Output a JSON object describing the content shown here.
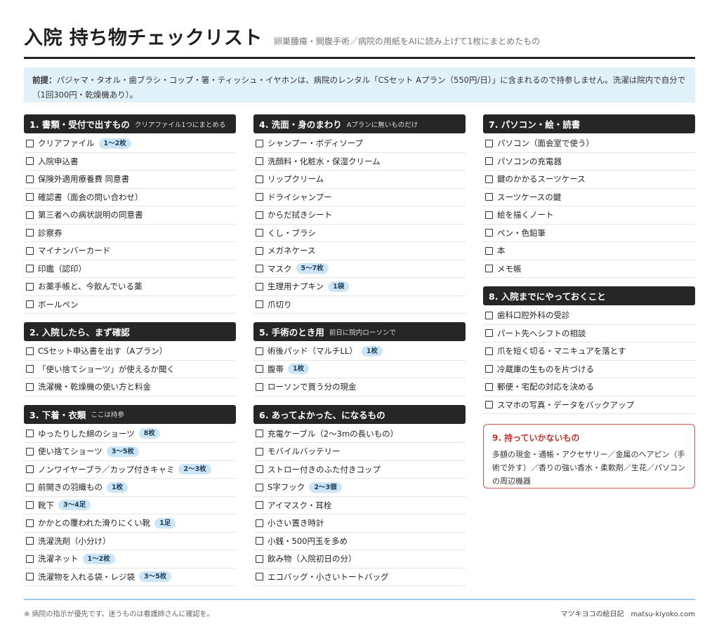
{
  "header": {
    "title": "入院 持ち物チェックリスト",
    "subtitle": "卵巣腫瘍・開腹手術／病院の用紙をAIに読み上げて1枚にまとめたもの"
  },
  "premise": {
    "label": "前提：",
    "text": "パジャマ・タオル・歯ブラシ・コップ・箸・ティッシュ・イヤホンは、病院のレンタル「CSセット Aプラン（550円/日）」に含まれるので持参しません。洗濯は院内で自分で（1回300円・乾燥機あり）。"
  },
  "sections": [
    {
      "title": "1. 書類・受付で出すもの",
      "note": "クリアファイル1つにまとめる",
      "items": [
        {
          "label": "クリアファイル",
          "badge": "1〜2枚"
        },
        {
          "label": "入院申込書"
        },
        {
          "label": "保険外適用療養費 同意書"
        },
        {
          "label": "確認書（面会の問い合わせ）"
        },
        {
          "label": "第三者への病状説明の同意書"
        },
        {
          "label": "診察券"
        },
        {
          "label": "マイナンバーカード"
        },
        {
          "label": "印鑑（認印）"
        },
        {
          "label": "お薬手帳と、今飲んでいる薬"
        },
        {
          "label": "ボールペン"
        }
      ]
    },
    {
      "title": "2. 入院したら、まず確認",
      "note": "",
      "items": [
        {
          "label": "CSセット申込書を出す（Aプラン）"
        },
        {
          "label": "「使い捨てショーツ」が使えるか聞く"
        },
        {
          "label": "洗濯機・乾燥機の使い方と料金"
        }
      ]
    },
    {
      "title": "3. 下着・衣類",
      "note": "ここは持参",
      "items": [
        {
          "label": "ゆったりした綿のショーツ",
          "badge": "8枚"
        },
        {
          "label": "使い捨てショーツ",
          "badge": "3〜5枚"
        },
        {
          "label": "ノンワイヤーブラ／カップ付きキャミ",
          "badge": "2〜3枚"
        },
        {
          "label": "前開きの羽織もの",
          "badge": "1枚"
        },
        {
          "label": "靴下",
          "badge": "3〜4足"
        },
        {
          "label": "かかとの覆われた滑りにくい靴",
          "badge": "1足"
        },
        {
          "label": "洗濯洗剤（小分け）"
        },
        {
          "label": "洗濯ネット",
          "badge": "1〜2枚"
        },
        {
          "label": "洗濯物を入れる袋・レジ袋",
          "badge": "3〜5枚"
        }
      ]
    },
    {
      "title": "4. 洗面・身のまわり",
      "note": "Aプランに無いものだけ",
      "items": [
        {
          "label": "シャンプー・ボディソープ"
        },
        {
          "label": "洗顔料・化粧水・保湿クリーム"
        },
        {
          "label": "リップクリーム"
        },
        {
          "label": "ドライシャンプー"
        },
        {
          "label": "からだ拭きシート"
        },
        {
          "label": "くし・ブラシ"
        },
        {
          "label": "メガネケース"
        },
        {
          "label": "マスク",
          "badge": "5〜7枚"
        },
        {
          "label": "生理用ナプキン",
          "badge": "1袋"
        },
        {
          "label": "爪切り"
        }
      ]
    },
    {
      "title": "5. 手術のとき用",
      "note": "前日に院内ローソンで",
      "items": [
        {
          "label": "術後パッド（マルチLL）",
          "badge": "1枚"
        },
        {
          "label": "腹帯",
          "badge": "1枚"
        },
        {
          "label": "ローソンで買う分の現金"
        }
      ]
    },
    {
      "title": "6. あってよかった、になるもの",
      "note": "",
      "items": [
        {
          "label": "充電ケーブル（2〜3mの長いもの）"
        },
        {
          "label": "モバイルバッテリー"
        },
        {
          "label": "ストロー付きのふた付きコップ"
        },
        {
          "label": "S字フック",
          "badge": "2〜3個"
        },
        {
          "label": "アイマスク・耳栓"
        },
        {
          "label": "小さい置き時計"
        },
        {
          "label": "小銭・500円玉を多め"
        },
        {
          "label": "飲み物（入院初日の分）"
        },
        {
          "label": "エコバッグ・小さいトートバッグ"
        }
      ]
    },
    {
      "title": "7. パソコン・絵・読書",
      "note": "",
      "items": [
        {
          "label": "パソコン（面会室で使う）"
        },
        {
          "label": "パソコンの充電器"
        },
        {
          "label": "鍵のかかるスーツケース"
        },
        {
          "label": "スーツケースの鍵"
        },
        {
          "label": "絵を描くノート"
        },
        {
          "label": "ペン・色鉛筆"
        },
        {
          "label": "本"
        },
        {
          "label": "メモ帳"
        }
      ]
    },
    {
      "title": "8. 入院までにやっておくこと",
      "note": "",
      "items": [
        {
          "label": "歯科口腔外科の受診"
        },
        {
          "label": "パート先へシフトの相談"
        },
        {
          "label": "爪を短く切る・マニキュアを落とす"
        },
        {
          "label": "冷蔵庫の生ものを片づける"
        },
        {
          "label": "郵便・宅配の対応を決める"
        },
        {
          "label": "スマホの写真・データをバックアップ"
        }
      ]
    }
  ],
  "not_bring": {
    "title": "9. 持っていかないもの",
    "text": "多額の現金・通帳・アクセサリー／金属のヘアピン（手術で外す）／香りの強い香水・柔軟剤／生花／パソコンの周辺機器"
  },
  "footer": {
    "note": "※ 病院の指示が優先です。迷うものは看護師さんに確認を。",
    "credit": "マツキヨコの絵日記　matsu-kiyoko.com"
  }
}
